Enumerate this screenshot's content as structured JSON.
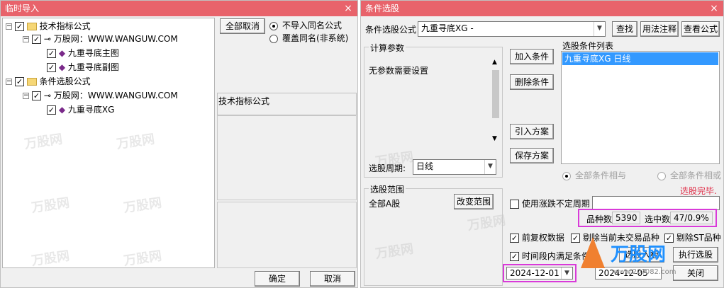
{
  "colors": {
    "titlebar": "#e8636b",
    "accent_selected": "#3399ff",
    "highlight_box": "#d93ad9",
    "status_red": "#e0304a"
  },
  "left_window": {
    "title": "临时导入",
    "close": "×",
    "tree": [
      {
        "label": "技术指标公式",
        "level": 0,
        "type": "folder"
      },
      {
        "label": "万股网：WWW.WANGUW.COM",
        "level": 1,
        "type": "key"
      },
      {
        "label": "九重寻底主图",
        "level": 2,
        "type": "item"
      },
      {
        "label": "九重寻底副图",
        "level": 2,
        "type": "item"
      },
      {
        "label": "条件选股公式",
        "level": 0,
        "type": "folder"
      },
      {
        "label": "万股网：WWW.WANGUW.COM",
        "level": 1,
        "type": "key"
      },
      {
        "label": "九重寻底XG",
        "level": 2,
        "type": "item"
      }
    ],
    "cancel_all_button": "全部取消",
    "radio_options": [
      {
        "label": "不导入同名公式",
        "selected": true
      },
      {
        "label": "覆盖同名(非系统)",
        "selected": false
      }
    ],
    "section_label": "技术指标公式",
    "ok_button": "确定",
    "cancel_button": "取消",
    "watermark": "万股网"
  },
  "right_window": {
    "title": "条件选股",
    "close": "×",
    "formula_label": "条件选股公式",
    "formula_value": "九重寻底XG  -",
    "find_button": "查找",
    "usage_button": "用法注释",
    "view_button": "查看公式",
    "params_title": "计算参数",
    "params_text": "无参数需要设置",
    "period_label": "选股周期:",
    "period_value": "日线",
    "add_condition": "加入条件",
    "delete_condition": "删除条件",
    "import_plan": "引入方案",
    "save_plan": "保存方案",
    "condition_list_label": "选股条件列表",
    "condition_items": [
      "九重寻底XG  日线"
    ],
    "all_and": "全部条件相与",
    "all_or": "全部条件相或",
    "status": "选股完毕.",
    "range_title": "选股范围",
    "range_value": "全部A股",
    "change_range": "改变范围",
    "use_period_label": "使用涨跌不定周期",
    "count_label": "品种数",
    "count_value": "5390",
    "selected_label": "选中数",
    "selected_value": "47/0.9%",
    "opt_fq": "前复权数据",
    "opt_remove_untraded": "剔除当前未交易品种",
    "opt_remove_st": "剔除ST品种",
    "opt_period": "时间段内满足条件",
    "select_into_button": "选股入板",
    "execute_button": "执行选股",
    "date_from": "2024-12-01",
    "date_to": "2024-12-05",
    "close_button": "关闭",
    "watermark": "万股网",
    "logo_text": "万股网",
    "logo_url": "www.20?082.com"
  }
}
